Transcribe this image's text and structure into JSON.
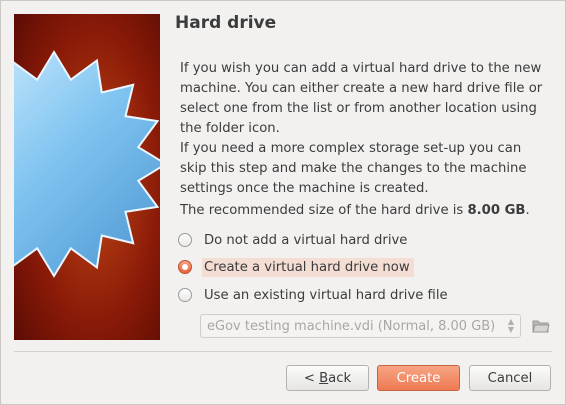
{
  "page": {
    "title": "Hard drive",
    "para1": "If you wish you can add a virtual hard drive to the new machine. You can either create a new hard drive file or select one from the list or from another location using the folder icon.",
    "para2": "If you need a more complex storage set-up you can skip this step and make the changes to the machine settings once the machine is created.",
    "recommend_prefix": "The recommended size of the hard drive is ",
    "recommend_size": "8.00 GB",
    "recommend_suffix": "."
  },
  "options": [
    {
      "label": "Do not add a virtual hard drive",
      "checked": false
    },
    {
      "label": "Create a virtual hard drive now",
      "checked": true
    },
    {
      "label": "Use an existing virtual hard drive file",
      "checked": false
    }
  ],
  "existing_file": {
    "selected": "eGov testing machine.vdi (Normal, 8.00 GB)",
    "enabled": false
  },
  "buttons": {
    "back_mnemonic": "B",
    "back_rest": "ack",
    "create": "Create",
    "cancel": "Cancel"
  },
  "colors": {
    "accent": "#ee7a52",
    "banner_bg": "#8a1a08",
    "starburst": "#7ec3f0"
  },
  "icons": {
    "folder": "folder-open-icon",
    "combo_arrows": "up-down-arrows-icon"
  }
}
